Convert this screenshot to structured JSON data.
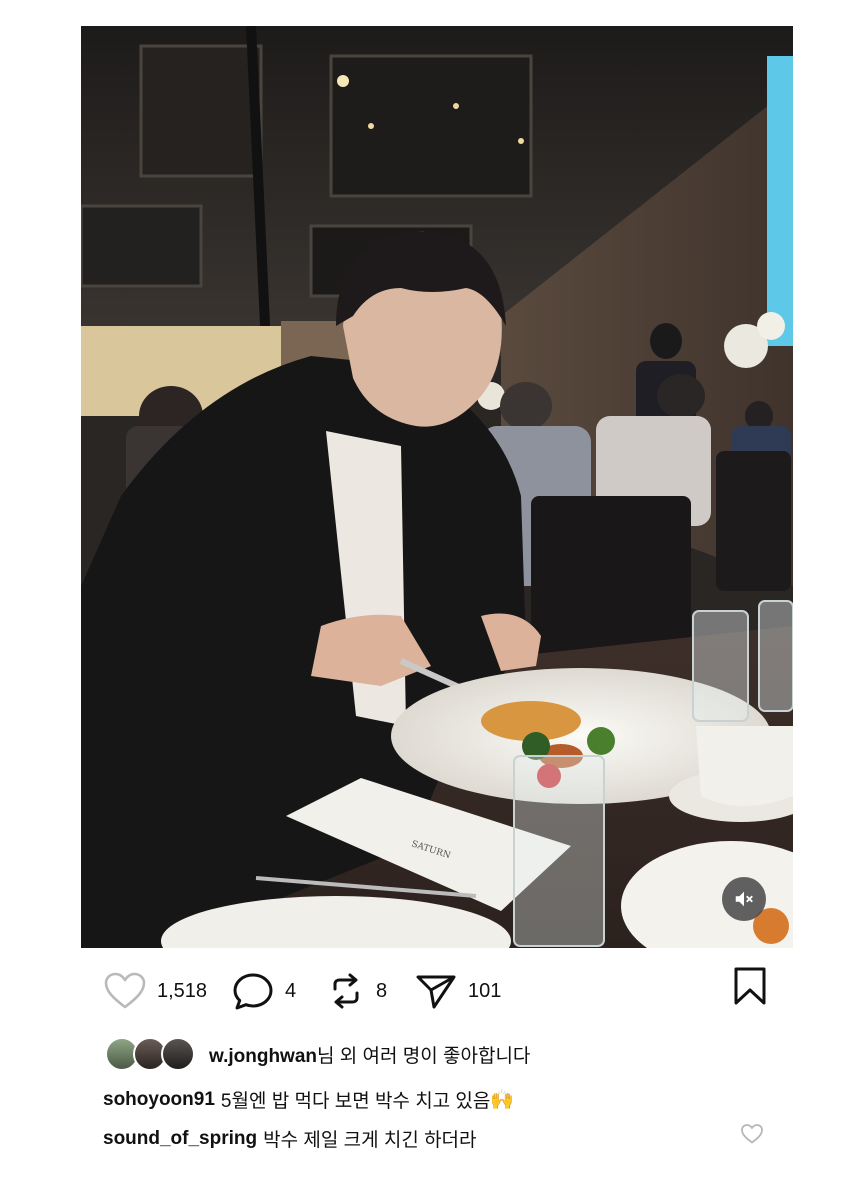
{
  "post": {
    "likes_count": "1,518",
    "comments_count": "4",
    "reposts_count": "8",
    "shares_count": "101"
  },
  "liked_by": {
    "user": "w.jonghwan",
    "suffix": "님 외 여러 명이 좋아합니다"
  },
  "comments": [
    {
      "user": "sohoyoon91",
      "text": "5월엔 밥 먹다 보면 박수 치고 있음",
      "emoji": "🙌"
    },
    {
      "user": "sound_of_spring",
      "text": "박수 제일 크게 치긴 하더라"
    }
  ],
  "menu_card": {
    "logo_text": "SATURN"
  },
  "icons": {
    "like": "heart-outline-icon",
    "comment": "speech-bubble-icon",
    "repost": "repost-arrows-icon",
    "share": "paper-plane-icon",
    "save": "bookmark-icon",
    "mute": "speaker-muted-icon",
    "comment_like": "small-heart-icon"
  },
  "colors": {
    "text": "#111111",
    "muted_heart": "#b7b7b7",
    "background": "#ffffff"
  }
}
